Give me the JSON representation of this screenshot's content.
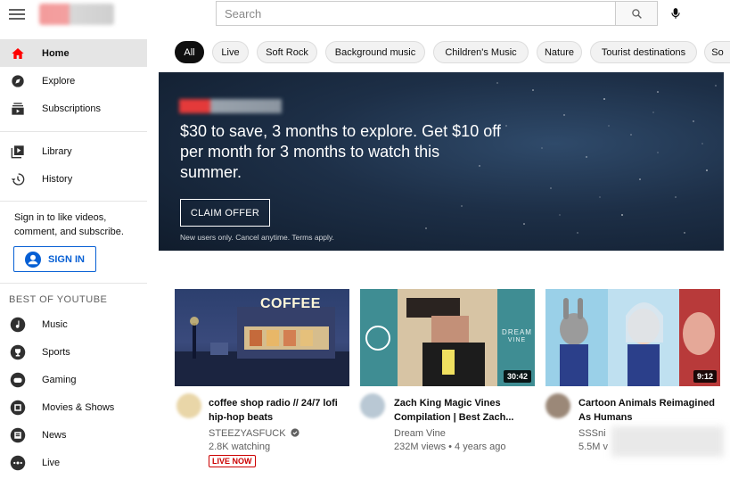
{
  "search": {
    "placeholder": "Search"
  },
  "sidebar": {
    "items": [
      {
        "label": "Home",
        "icon": "home-icon"
      },
      {
        "label": "Explore",
        "icon": "compass-icon"
      },
      {
        "label": "Subscriptions",
        "icon": "subscriptions-icon"
      },
      {
        "label": "Library",
        "icon": "library-icon"
      },
      {
        "label": "History",
        "icon": "history-icon"
      }
    ],
    "signin_text": "Sign in to like videos, comment, and subscribe.",
    "signin_button": "SIGN IN",
    "section_title": "BEST OF YOUTUBE",
    "best_of": [
      {
        "label": "Music",
        "icon": "music-icon"
      },
      {
        "label": "Sports",
        "icon": "trophy-icon"
      },
      {
        "label": "Gaming",
        "icon": "gamepad-icon"
      },
      {
        "label": "Movies & Shows",
        "icon": "movies-icon"
      },
      {
        "label": "News",
        "icon": "news-icon"
      },
      {
        "label": "Live",
        "icon": "live-icon"
      }
    ]
  },
  "chips": [
    "All",
    "Live",
    "Soft Rock",
    "Background music",
    "Children's Music",
    "Nature",
    "Tourist destinations",
    "So"
  ],
  "banner": {
    "headline": "$30 to save, 3 months to explore. Get $10 off per month for 3 months to watch this summer.",
    "cta": "CLAIM OFFER",
    "fineprint": "New users only. Cancel anytime. Terms apply."
  },
  "videos": [
    {
      "title": "coffee shop radio // 24/7 lofi hip-hop beats",
      "channel": "STEEZYASFUCK",
      "verified_icon": "check-circle-icon",
      "meta": "2.8K watching",
      "badge": "LIVE NOW",
      "thumb_text": "COFFEE"
    },
    {
      "title": "Zach King Magic Vines Compilation | Best Zach...",
      "channel": "Dream Vine",
      "meta": "232M views • 4 years ago",
      "duration": "30:42",
      "thumb_text_1": "DREAM",
      "thumb_text_2": "VINE"
    },
    {
      "title": "Cartoon Animals Reimagined As Humans",
      "channel": "SSSni",
      "meta": "5.5M v",
      "duration": "9:12"
    }
  ],
  "colors": {
    "accent": "#065fd4",
    "brand_red": "#ff0000",
    "live_red": "#cc0000"
  }
}
